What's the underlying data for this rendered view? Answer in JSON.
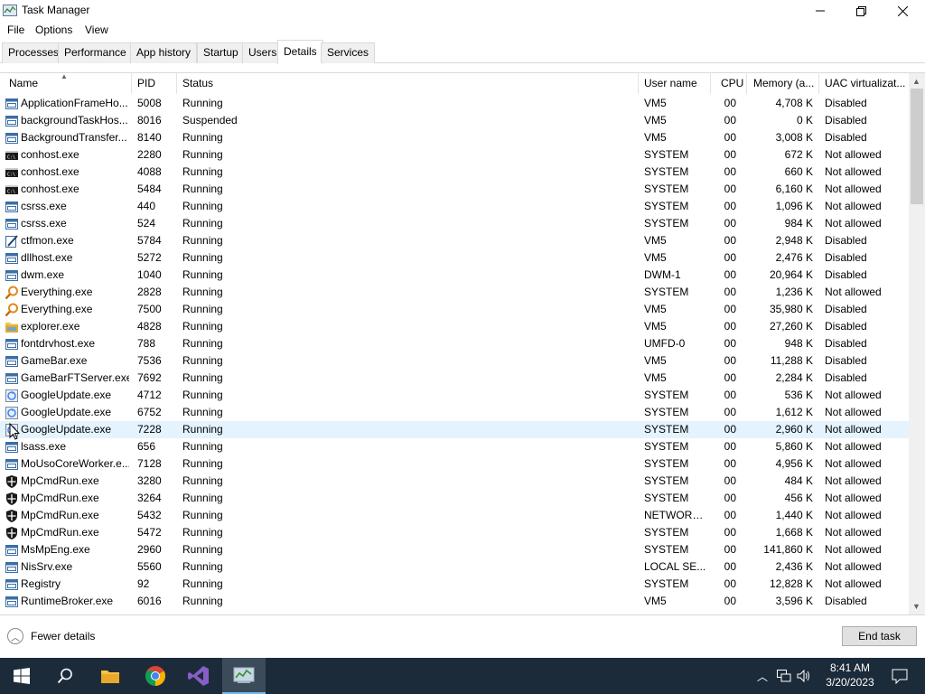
{
  "window": {
    "title": "Task Manager",
    "min_icon": "minimize-icon",
    "max_icon": "restore-icon",
    "close_icon": "close-icon"
  },
  "menu": {
    "file": "File",
    "options": "Options",
    "view": "View"
  },
  "tabs": {
    "processes": "Processes",
    "performance": "Performance",
    "app_history": "App history",
    "startup": "Startup",
    "users": "Users",
    "details": "Details",
    "services": "Services",
    "active": "Details"
  },
  "columns": {
    "name": "Name",
    "pid": "PID",
    "status": "Status",
    "user": "User name",
    "cpu": "CPU",
    "memory": "Memory (a...",
    "uac": "UAC virtualizat..."
  },
  "rows": [
    {
      "icon": "app-window-icon",
      "name": "ApplicationFrameHo...",
      "pid": "5008",
      "status": "Running",
      "user": "VM5",
      "cpu": "00",
      "memory": "4,708 K",
      "uac": "Disabled"
    },
    {
      "icon": "app-window-icon",
      "name": "backgroundTaskHos...",
      "pid": "8016",
      "status": "Suspended",
      "user": "VM5",
      "cpu": "00",
      "memory": "0 K",
      "uac": "Disabled"
    },
    {
      "icon": "app-window-icon",
      "name": "BackgroundTransfer...",
      "pid": "8140",
      "status": "Running",
      "user": "VM5",
      "cpu": "00",
      "memory": "3,008 K",
      "uac": "Disabled"
    },
    {
      "icon": "console-icon",
      "name": "conhost.exe",
      "pid": "2280",
      "status": "Running",
      "user": "SYSTEM",
      "cpu": "00",
      "memory": "672 K",
      "uac": "Not allowed"
    },
    {
      "icon": "console-icon",
      "name": "conhost.exe",
      "pid": "4088",
      "status": "Running",
      "user": "SYSTEM",
      "cpu": "00",
      "memory": "660 K",
      "uac": "Not allowed"
    },
    {
      "icon": "console-icon",
      "name": "conhost.exe",
      "pid": "5484",
      "status": "Running",
      "user": "SYSTEM",
      "cpu": "00",
      "memory": "6,160 K",
      "uac": "Not allowed"
    },
    {
      "icon": "app-window-icon",
      "name": "csrss.exe",
      "pid": "440",
      "status": "Running",
      "user": "SYSTEM",
      "cpu": "00",
      "memory": "1,096 K",
      "uac": "Not allowed"
    },
    {
      "icon": "app-window-icon",
      "name": "csrss.exe",
      "pid": "524",
      "status": "Running",
      "user": "SYSTEM",
      "cpu": "00",
      "memory": "984 K",
      "uac": "Not allowed"
    },
    {
      "icon": "pen-icon",
      "name": "ctfmon.exe",
      "pid": "5784",
      "status": "Running",
      "user": "VM5",
      "cpu": "00",
      "memory": "2,948 K",
      "uac": "Disabled"
    },
    {
      "icon": "app-window-icon",
      "name": "dllhost.exe",
      "pid": "5272",
      "status": "Running",
      "user": "VM5",
      "cpu": "00",
      "memory": "2,476 K",
      "uac": "Disabled"
    },
    {
      "icon": "app-window-icon",
      "name": "dwm.exe",
      "pid": "1040",
      "status": "Running",
      "user": "DWM-1",
      "cpu": "00",
      "memory": "20,964 K",
      "uac": "Disabled"
    },
    {
      "icon": "magnifier-icon",
      "name": "Everything.exe",
      "pid": "2828",
      "status": "Running",
      "user": "SYSTEM",
      "cpu": "00",
      "memory": "1,236 K",
      "uac": "Not allowed"
    },
    {
      "icon": "magnifier-icon",
      "name": "Everything.exe",
      "pid": "7500",
      "status": "Running",
      "user": "VM5",
      "cpu": "00",
      "memory": "35,980 K",
      "uac": "Disabled"
    },
    {
      "icon": "folder-icon",
      "name": "explorer.exe",
      "pid": "4828",
      "status": "Running",
      "user": "VM5",
      "cpu": "00",
      "memory": "27,260 K",
      "uac": "Disabled"
    },
    {
      "icon": "app-window-icon",
      "name": "fontdrvhost.exe",
      "pid": "788",
      "status": "Running",
      "user": "UMFD-0",
      "cpu": "00",
      "memory": "948 K",
      "uac": "Disabled"
    },
    {
      "icon": "app-window-icon",
      "name": "GameBar.exe",
      "pid": "7536",
      "status": "Running",
      "user": "VM5",
      "cpu": "00",
      "memory": "11,288 K",
      "uac": "Disabled"
    },
    {
      "icon": "app-window-icon",
      "name": "GameBarFTServer.exe",
      "pid": "7692",
      "status": "Running",
      "user": "VM5",
      "cpu": "00",
      "memory": "2,284 K",
      "uac": "Disabled"
    },
    {
      "icon": "google-update-icon",
      "name": "GoogleUpdate.exe",
      "pid": "4712",
      "status": "Running",
      "user": "SYSTEM",
      "cpu": "00",
      "memory": "536 K",
      "uac": "Not allowed"
    },
    {
      "icon": "google-update-icon",
      "name": "GoogleUpdate.exe",
      "pid": "6752",
      "status": "Running",
      "user": "SYSTEM",
      "cpu": "00",
      "memory": "1,612 K",
      "uac": "Not allowed"
    },
    {
      "icon": "google-update-icon",
      "name": "GoogleUpdate.exe",
      "pid": "7228",
      "status": "Running",
      "user": "SYSTEM",
      "cpu": "00",
      "memory": "2,960 K",
      "uac": "Not allowed",
      "selected": true
    },
    {
      "icon": "app-window-icon",
      "name": "lsass.exe",
      "pid": "656",
      "status": "Running",
      "user": "SYSTEM",
      "cpu": "00",
      "memory": "5,860 K",
      "uac": "Not allowed"
    },
    {
      "icon": "app-window-icon",
      "name": "MoUsoCoreWorker.e...",
      "pid": "7128",
      "status": "Running",
      "user": "SYSTEM",
      "cpu": "00",
      "memory": "4,956 K",
      "uac": "Not allowed"
    },
    {
      "icon": "shield-icon",
      "name": "MpCmdRun.exe",
      "pid": "3280",
      "status": "Running",
      "user": "SYSTEM",
      "cpu": "00",
      "memory": "484 K",
      "uac": "Not allowed"
    },
    {
      "icon": "shield-icon",
      "name": "MpCmdRun.exe",
      "pid": "3264",
      "status": "Running",
      "user": "SYSTEM",
      "cpu": "00",
      "memory": "456 K",
      "uac": "Not allowed"
    },
    {
      "icon": "shield-icon",
      "name": "MpCmdRun.exe",
      "pid": "5432",
      "status": "Running",
      "user": "NETWORK...",
      "cpu": "00",
      "memory": "1,440 K",
      "uac": "Not allowed"
    },
    {
      "icon": "shield-icon",
      "name": "MpCmdRun.exe",
      "pid": "5472",
      "status": "Running",
      "user": "SYSTEM",
      "cpu": "00",
      "memory": "1,668 K",
      "uac": "Not allowed"
    },
    {
      "icon": "app-window-icon",
      "name": "MsMpEng.exe",
      "pid": "2960",
      "status": "Running",
      "user": "SYSTEM",
      "cpu": "00",
      "memory": "141,860 K",
      "uac": "Not allowed"
    },
    {
      "icon": "app-window-icon",
      "name": "NisSrv.exe",
      "pid": "5560",
      "status": "Running",
      "user": "LOCAL SE...",
      "cpu": "00",
      "memory": "2,436 K",
      "uac": "Not allowed"
    },
    {
      "icon": "app-window-icon",
      "name": "Registry",
      "pid": "92",
      "status": "Running",
      "user": "SYSTEM",
      "cpu": "00",
      "memory": "12,828 K",
      "uac": "Not allowed"
    },
    {
      "icon": "app-window-icon",
      "name": "RuntimeBroker.exe",
      "pid": "6016",
      "status": "Running",
      "user": "VM5",
      "cpu": "00",
      "memory": "3,596 K",
      "uac": "Disabled"
    }
  ],
  "bottom": {
    "fewer_details": "Fewer details",
    "end_task": "End task"
  },
  "taskbar": {
    "time": "8:41 AM",
    "date": "3/20/2023"
  },
  "colors": {
    "selected_row": "#e5f3ff",
    "taskbar_bg": "#1c2b3a"
  }
}
